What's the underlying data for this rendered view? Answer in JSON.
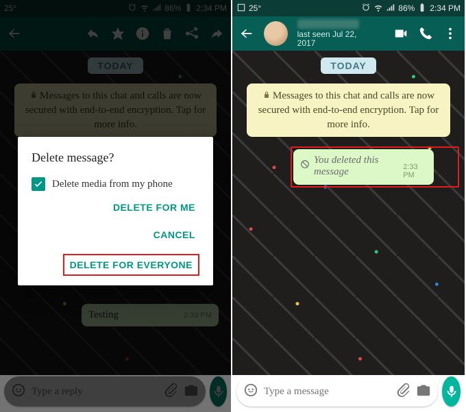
{
  "status": {
    "temp": "25°",
    "battery_pct": "86%",
    "time": "2:34 PM"
  },
  "chat": {
    "date_chip": "TODAY",
    "encryption_notice": "Messages to this chat and calls are now secured with end-to-end encryption. Tap for more info.",
    "last_seen": "last seen Jul 22, 2017"
  },
  "left": {
    "placeholder": "Type a reply",
    "testing_text": "Testing",
    "testing_time": "2:33 PM"
  },
  "right": {
    "placeholder": "Type a message",
    "deleted_text": "You deleted this message",
    "deleted_time": "2:33 PM"
  },
  "dialog": {
    "title": "Delete message?",
    "checkbox_label": "Delete media from my phone",
    "delete_for_me": "DELETE FOR ME",
    "cancel": "CANCEL",
    "delete_for_everyone": "DELETE FOR EVERYONE"
  }
}
